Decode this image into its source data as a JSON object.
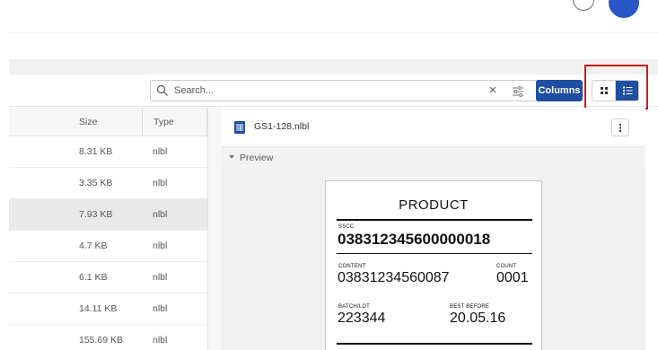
{
  "toolbar": {
    "search_placeholder": "Search...",
    "clear_icon": "close-icon",
    "filter_icon": "filter-icon",
    "columns_label": "Columns",
    "view_options": [
      "grid-view",
      "list-view"
    ],
    "active_view": "list-view",
    "accent": "#1f4fa3"
  },
  "table": {
    "headers": {
      "size": "Size",
      "type": "Type"
    },
    "rows": [
      {
        "size": "8.31 KB",
        "type": "nlbl"
      },
      {
        "size": "3.35 KB",
        "type": "nlbl"
      },
      {
        "size": "7.93 KB",
        "type": "nlbl",
        "selected": true
      },
      {
        "size": "4.7 KB",
        "type": "nlbl"
      },
      {
        "size": "6.1 KB",
        "type": "nlbl"
      },
      {
        "size": "14.11 KB",
        "type": "nlbl"
      },
      {
        "size": "155.69 KB",
        "type": "nlbl"
      }
    ]
  },
  "panel": {
    "file_name": "GS1-128.nlbl",
    "file_icon": "barcode-file-icon",
    "preview_label": "Preview"
  },
  "label": {
    "product": "PRODUCT",
    "sscc_label": "SSCC",
    "sscc_value": "038312345600000018",
    "content_label": "CONTENT",
    "content_value": "03831234560087",
    "count_label": "COUNT",
    "count_value": "0001",
    "batch_label": "BATCH/LOT",
    "batch_value": "223344",
    "best_before_label": "BEST BEFORE",
    "best_before_value": "20.05.16"
  },
  "highlight_color": "#c81b1b"
}
